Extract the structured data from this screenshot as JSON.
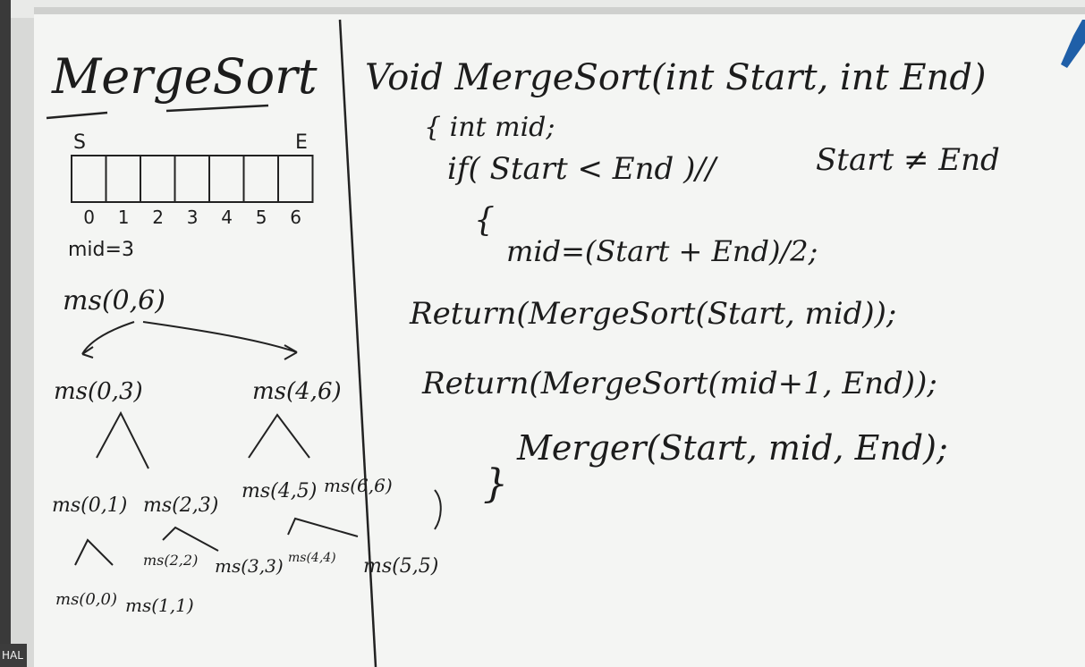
{
  "colors": {
    "board": "#f4f5f3",
    "ink": "#1c1c1c",
    "frame": "#2a2a2a",
    "marker_blue": "#1f5fa8"
  },
  "left_panel": {
    "title": "MergeSort",
    "array": {
      "start_marker": "S",
      "end_marker": "E",
      "cell_count": 7,
      "indices": [
        "0",
        "1",
        "2",
        "3",
        "4",
        "5",
        "6"
      ]
    },
    "mid_note": "mid=3",
    "tree": {
      "root": "ms(0,6)",
      "level1": [
        "ms(0,3)",
        "ms(4,6)"
      ],
      "level2": [
        "ms(0,1)",
        "ms(2,3)",
        "ms(4,5)",
        "ms(6,6)"
      ],
      "level3": [
        "ms(2,2)",
        "ms(3,3)",
        "ms(4,4)",
        "ms(5,5)"
      ],
      "level4": [
        "ms(0,0)",
        "ms(1,1)"
      ]
    }
  },
  "code": {
    "signature": "Void MergeSort(int Start, int End)",
    "open_brace_decl": "{ int mid;",
    "if_line": "if( Start < End )//",
    "comment": "Start ≠ End",
    "block_open": "{",
    "mid_line": "mid=(Start + End)/2;",
    "return1": "Return(MergeSort(Start, mid));",
    "return2": "Return(MergeSort(mid+1, End));",
    "merger": "Merger(Start, mid, End);",
    "close_brace": "}"
  },
  "corner_badge": "HAL"
}
